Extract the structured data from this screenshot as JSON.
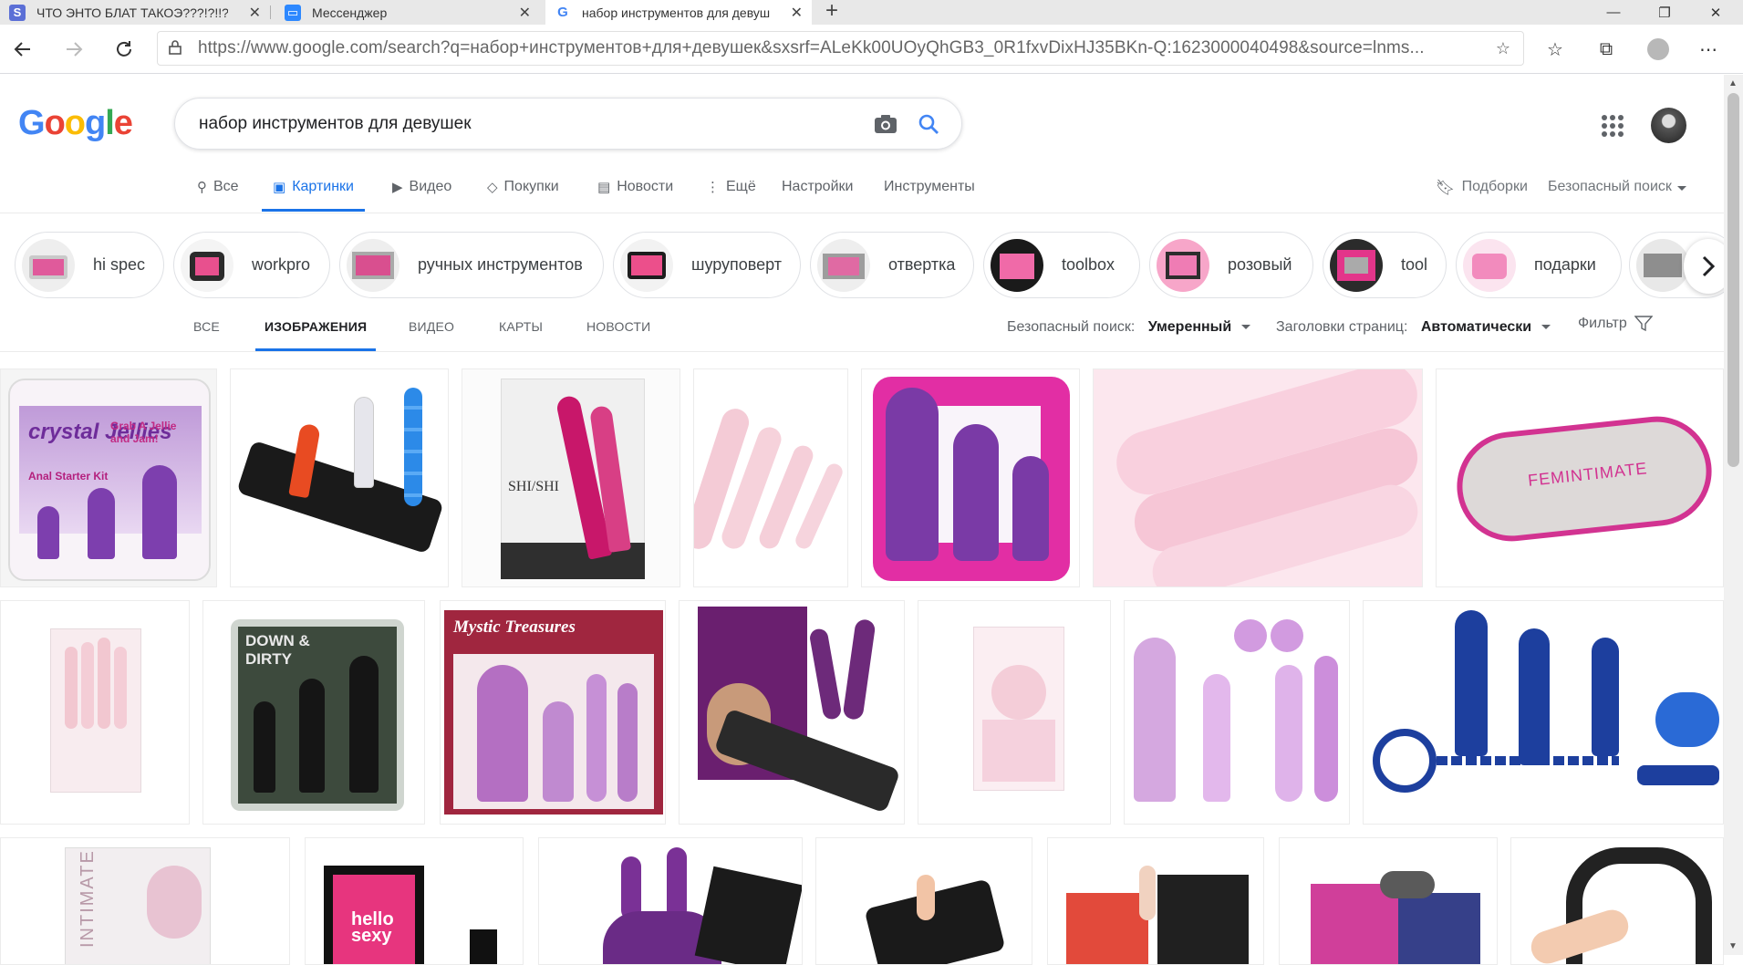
{
  "browser": {
    "tabs": [
      {
        "title": "ЧТО ЭНТО БЛАТ ТАКОЭ???!?!!?",
        "icon": "s-app-icon",
        "active": false
      },
      {
        "title": "Мессенджер",
        "icon": "messenger-icon",
        "active": false
      },
      {
        "title": "набор инструментов для девуш",
        "icon": "google-g-icon",
        "active": true
      }
    ],
    "url": "https://www.google.com/search?q=набор+инструментов+для+девушек&sxsrf=ALeKk00UOyQhGB3_0R1fxvDixHJ35BKn-Q:1623000040498&source=lnms..."
  },
  "google": {
    "logo": "Google",
    "query": "набор инструментов для девушек",
    "tabs": [
      {
        "label": "Все",
        "icon": "search-icon"
      },
      {
        "label": "Картинки",
        "icon": "image-icon",
        "active": true
      },
      {
        "label": "Видео",
        "icon": "video-icon"
      },
      {
        "label": "Покупки",
        "icon": "tag-icon"
      },
      {
        "label": "Новости",
        "icon": "news-icon"
      },
      {
        "label": "Ещё",
        "icon": "more-vert-icon"
      },
      {
        "label": "Настройки"
      },
      {
        "label": "Инструменты"
      }
    ],
    "collections": "Подборки",
    "safesearch_top": "Безопасный поиск"
  },
  "chips": [
    "hi spec",
    "workpro",
    "ручных инструментов",
    "шуруповерт",
    "отвертка",
    "toolbox",
    "розовый",
    "tool",
    "подарки"
  ],
  "subnav": {
    "items": [
      "ВСЕ",
      "ИЗОБРАЖЕНИЯ",
      "ВИДЕО",
      "КАРТЫ",
      "НОВОСТИ"
    ],
    "active": "ИЗОБРАЖЕНИЯ",
    "safesearch_label": "Безопасный поиск:",
    "safesearch_value": "Умеренный",
    "titles_label": "Заголовки страниц:",
    "titles_value": "Автоматически",
    "filter": "Фильтр"
  },
  "image_texts": {
    "jellies_title": "crystal Jellies",
    "jellies_sub": "Anal Starter Kit",
    "jellies_tag": "Grab A Jellie and Jam!",
    "shi_shi": "SHI/SHI",
    "femintimate": "FEMINTIMATE",
    "down_dirty": "DOWN & DIRTY",
    "mystic": "Mystic Treasures",
    "intimate": "INTIMATE",
    "hello_sexy": "hello sexy"
  },
  "colors": {
    "accent": "#1a73e8",
    "purple": "#7b3aa8",
    "magenta": "#d12b8f",
    "pink_light": "#f6cfd8",
    "blue_toy": "#1d3f9e"
  }
}
